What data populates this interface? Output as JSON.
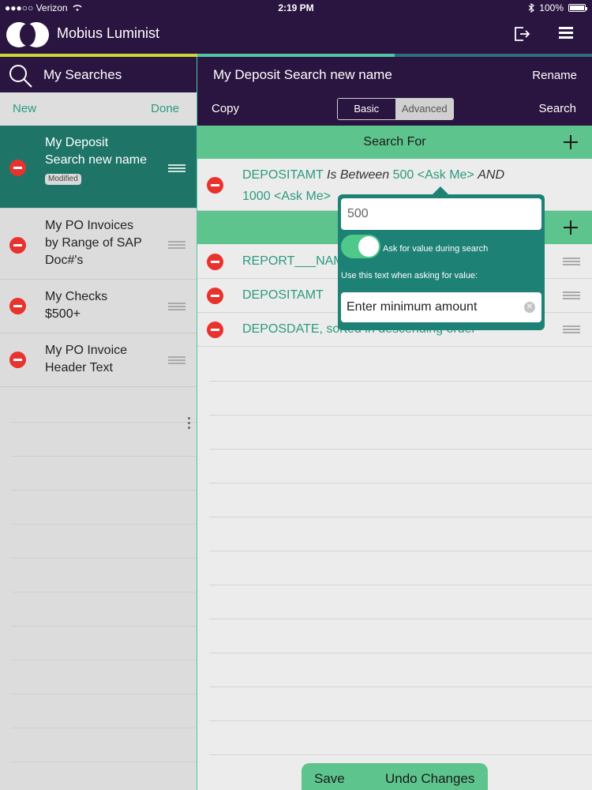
{
  "status_bar": {
    "carrier": "●●●○○ Verizon",
    "time": "2:19 PM",
    "battery": "100%"
  },
  "app": {
    "name": "Mobius Luminist"
  },
  "left": {
    "title": "My Searches",
    "new_label": "New",
    "done_label": "Done",
    "items": [
      {
        "line1": "My Deposit",
        "line2": "Search new name",
        "badge": "Modified"
      },
      {
        "line1": "My PO Invoices",
        "line2": "by Range of SAP",
        "line3": "Doc#'s"
      },
      {
        "line1": "My Checks",
        "line2": "$500+"
      },
      {
        "line1": "My PO Invoice",
        "line2": "Header Text"
      }
    ]
  },
  "right": {
    "title": "My Deposit Search new name",
    "rename_label": "Rename",
    "copy_label": "Copy",
    "search_label": "Search",
    "seg_basic": "Basic",
    "seg_advanced": "Advanced",
    "section_search_for": "Search For",
    "criteria": {
      "field": "DEPOSITAMT",
      "op": "Is Between",
      "val1": "500 <Ask Me>",
      "and": "AND",
      "val2": "1000 <Ask Me>"
    },
    "rows": [
      {
        "text": "REPORT___NAM"
      },
      {
        "text": "DEPOSITAMT"
      },
      {
        "text": "DEPOSDATE, sorted in descending order"
      }
    ],
    "popover": {
      "value": "500",
      "toggle_label": "Ask for value during search",
      "hint": "Use this text when asking for value:",
      "prompt_value": "Enter minimum amount"
    }
  },
  "bottom": {
    "save_label": "Save",
    "undo_label": "Undo Changes"
  }
}
